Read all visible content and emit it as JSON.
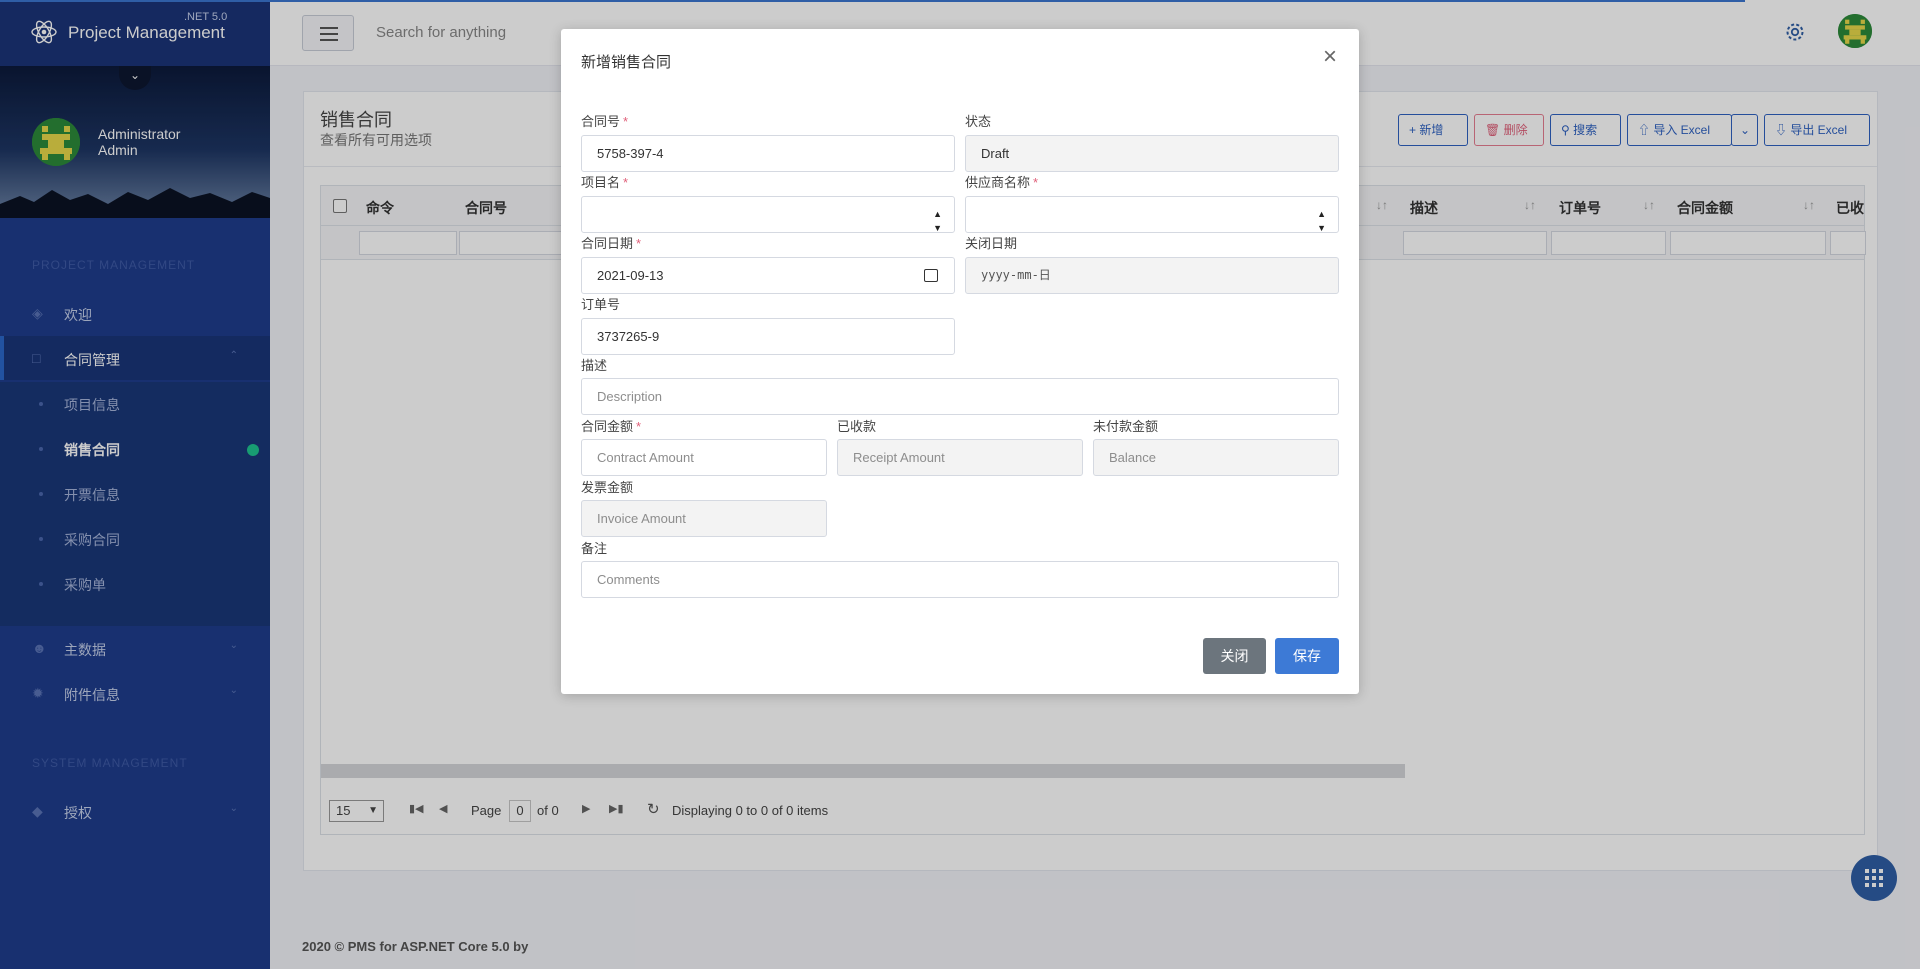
{
  "app": {
    "brand": "Project Management",
    "version": ".NET 5.0"
  },
  "user": {
    "name": "Administrator",
    "role": "Admin"
  },
  "sidebar": {
    "section1": "PROJECT MANAGEMENT",
    "section2": "SYSTEM MANAGEMENT",
    "items": [
      {
        "label": "欢迎"
      },
      {
        "label": "合同管理"
      },
      {
        "label": "主数据"
      },
      {
        "label": "附件信息"
      },
      {
        "label": "授权"
      }
    ],
    "subitems": [
      {
        "label": "项目信息"
      },
      {
        "label": "销售合同"
      },
      {
        "label": "开票信息"
      },
      {
        "label": "采购合同"
      },
      {
        "label": "采购单"
      }
    ]
  },
  "topbar": {
    "search_placeholder": "Search for anything"
  },
  "page": {
    "title": "销售合同",
    "subtitle": "查看所有可用选项"
  },
  "toolbar": {
    "add": "新增",
    "delete": "删除",
    "search": "搜索",
    "import": "导入 Excel",
    "export": "导出 Excel"
  },
  "grid": {
    "columns": [
      "命令",
      "合同号",
      "描述",
      "订单号",
      "合同金额",
      "已收"
    ]
  },
  "pager": {
    "page_size": "15",
    "page_label": "Page",
    "page": "0",
    "of_label": "of 0",
    "status": "Displaying 0 to 0 of 0 items"
  },
  "footer": {
    "text": "2020 © PMS for ASP.NET Core 5.0 by"
  },
  "modal": {
    "title": "新增销售合同",
    "fields": {
      "contract_no": {
        "label": "合同号",
        "value": "5758-397-4"
      },
      "status": {
        "label": "状态",
        "value": "Draft"
      },
      "project": {
        "label": "项目名",
        "value": ""
      },
      "supplier": {
        "label": "供应商名称",
        "value": ""
      },
      "contract_date": {
        "label": "合同日期",
        "value": "2021-09-13"
      },
      "close_date": {
        "label": "关闭日期",
        "placeholder": "yyyy-mm-日"
      },
      "order_no": {
        "label": "订单号",
        "value": "3737265-9"
      },
      "description": {
        "label": "描述",
        "placeholder": "Description"
      },
      "amount": {
        "label": "合同金额",
        "placeholder": "Contract Amount"
      },
      "received": {
        "label": "已收款",
        "placeholder": "Receipt Amount"
      },
      "unpaid": {
        "label": "未付款金额",
        "placeholder": "Balance"
      },
      "invoice": {
        "label": "发票金额",
        "placeholder": "Invoice Amount"
      },
      "comments": {
        "label": "备注",
        "placeholder": "Comments"
      }
    },
    "required_mark": "*",
    "close_button": "关闭",
    "save_button": "保存"
  }
}
